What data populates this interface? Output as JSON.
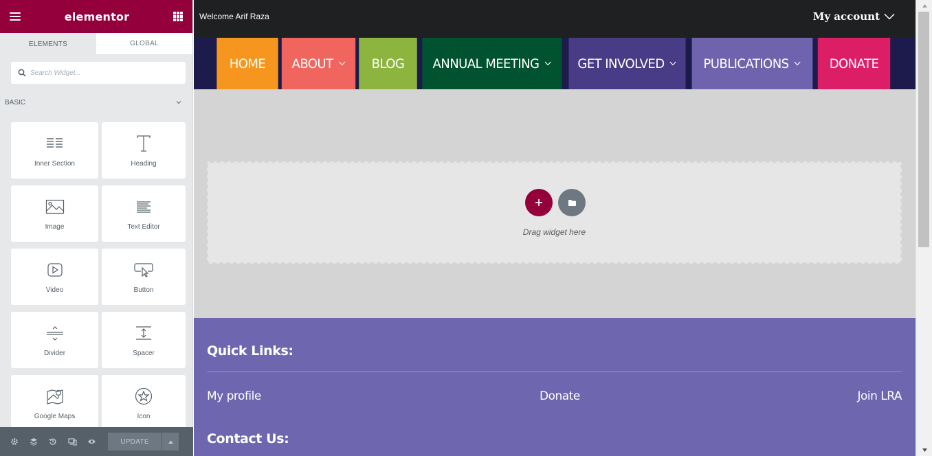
{
  "panel": {
    "logo": "elementor",
    "tabs": [
      {
        "label": "ELEMENTS",
        "active": true
      },
      {
        "label": "GLOBAL",
        "active": false
      }
    ],
    "search": {
      "placeholder": "Search Widget..."
    },
    "category": "BASIC",
    "widgets": [
      {
        "label": "Inner Section",
        "icon": "inner-section-icon"
      },
      {
        "label": "Heading",
        "icon": "heading-icon"
      },
      {
        "label": "Image",
        "icon": "image-icon"
      },
      {
        "label": "Text Editor",
        "icon": "text-editor-icon"
      },
      {
        "label": "Video",
        "icon": "video-icon"
      },
      {
        "label": "Button",
        "icon": "button-icon"
      },
      {
        "label": "Divider",
        "icon": "divider-icon"
      },
      {
        "label": "Spacer",
        "icon": "spacer-icon"
      },
      {
        "label": "Google Maps",
        "icon": "google-maps-icon"
      },
      {
        "label": "Icon",
        "icon": "star-icon"
      }
    ],
    "footer": {
      "icons": [
        "settings-icon",
        "navigator-icon",
        "history-icon",
        "responsive-icon",
        "preview-icon"
      ],
      "update_label": "UPDATE"
    }
  },
  "preview": {
    "welcome": "Welcome Arif Raza",
    "account": "My account",
    "nav": [
      {
        "label": "HOME",
        "color": "#f7961e",
        "dropdown": false
      },
      {
        "label": "ABOUT",
        "color": "#f0665f",
        "dropdown": true
      },
      {
        "label": "BLOG",
        "color": "#8cb43e",
        "dropdown": false
      },
      {
        "label": "ANNUAL MEETING",
        "color": "#01532f",
        "dropdown": true
      },
      {
        "label": "GET INVOLVED",
        "color": "#493c86",
        "dropdown": true
      },
      {
        "label": "PUBLICATIONS",
        "color": "#7063ad",
        "dropdown": true
      },
      {
        "label": "DONATE",
        "color": "#db1e66",
        "dropdown": false
      }
    ],
    "dropzone": {
      "text": "Drag widget here"
    },
    "footer": {
      "quick_links_title": "Quick Links:",
      "links": [
        "My profile",
        "Donate",
        "Join LRA"
      ],
      "contact_title": "Contact Us:"
    }
  },
  "colors": {
    "brand": "#93003c",
    "panel_bg": "#e6e8ea",
    "panel_footer": "#556068",
    "footer_bg": "#6e66ae"
  }
}
